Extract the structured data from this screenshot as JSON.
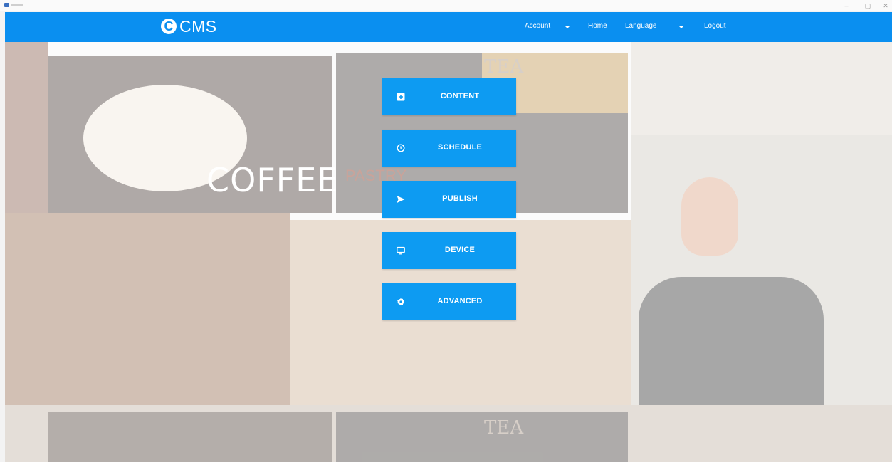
{
  "window": {
    "minimize": "–",
    "maximize": "▢",
    "close": "✕"
  },
  "brand": {
    "logo_letter": "C",
    "name": "CMS",
    "color": "#0a8ff0"
  },
  "nav": {
    "account": "Account",
    "home": "Home",
    "language": "Language",
    "logout": "Logout"
  },
  "background": {
    "coffee": "COFFEE",
    "pastry": "PASTRY",
    "tea": "TEA"
  },
  "menu": [
    {
      "label": "CONTENT",
      "icon": "plus-square-icon"
    },
    {
      "label": "SCHEDULE",
      "icon": "clock-icon"
    },
    {
      "label": "PUBLISH",
      "icon": "send-icon"
    },
    {
      "label": "DEVICE",
      "icon": "monitor-icon"
    },
    {
      "label": "ADVANCED",
      "icon": "gear-icon"
    }
  ],
  "colors": {
    "button": "#0d9bf2",
    "text": "#ffffff"
  }
}
